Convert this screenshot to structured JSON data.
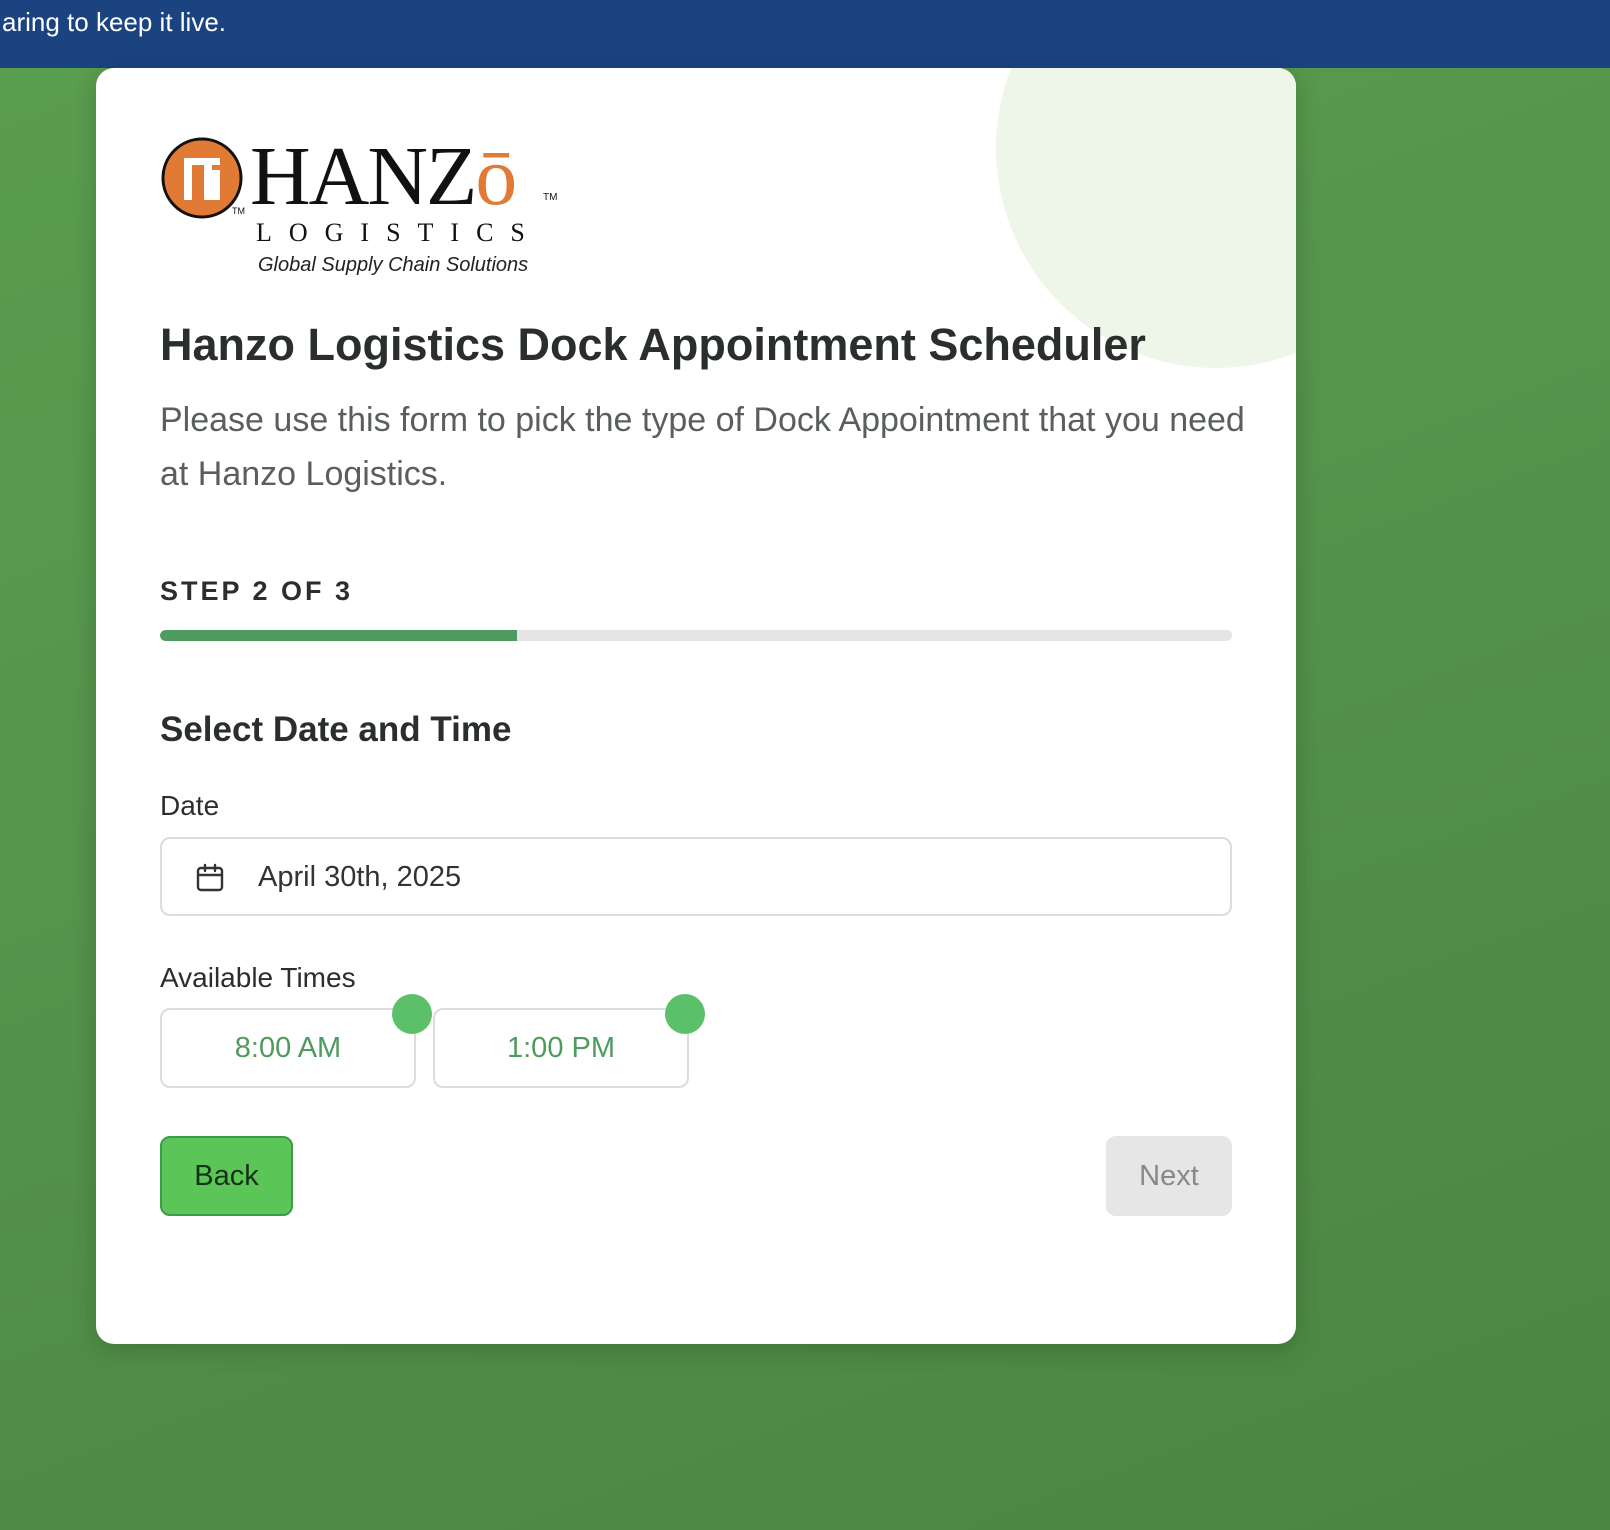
{
  "banner": {
    "text": "aring to keep it live."
  },
  "logo": {
    "word_main": "HANZ",
    "word_accent": "ō",
    "tm": "TM",
    "sub": "LOGISTICS",
    "tagline": "Global Supply Chain Solutions",
    "colors": {
      "accent": "#e07a35",
      "ink": "#111111"
    }
  },
  "header": {
    "title": "Hanzo Logistics Dock Appointment Scheduler",
    "description": "Please use this form to pick the type of Dock Appointment that you need at Hanzo Logistics."
  },
  "stepper": {
    "label": "STEP 2 OF 3",
    "progress_percent": 33.3
  },
  "section": {
    "title": "Select Date and Time"
  },
  "date_field": {
    "label": "Date",
    "value": "April 30th, 2025",
    "icon": "calendar-icon"
  },
  "times": {
    "label": "Available Times",
    "slots": [
      {
        "label": "8:00 AM"
      },
      {
        "label": "1:00 PM"
      }
    ]
  },
  "actions": {
    "back_label": "Back",
    "next_label": "Next",
    "next_disabled": true
  },
  "colors": {
    "banner": "#1a4380",
    "background": "#52914a",
    "progress": "#4f9a5f",
    "back_button": "#5bc657",
    "slot_dot": "#5cc06a"
  }
}
